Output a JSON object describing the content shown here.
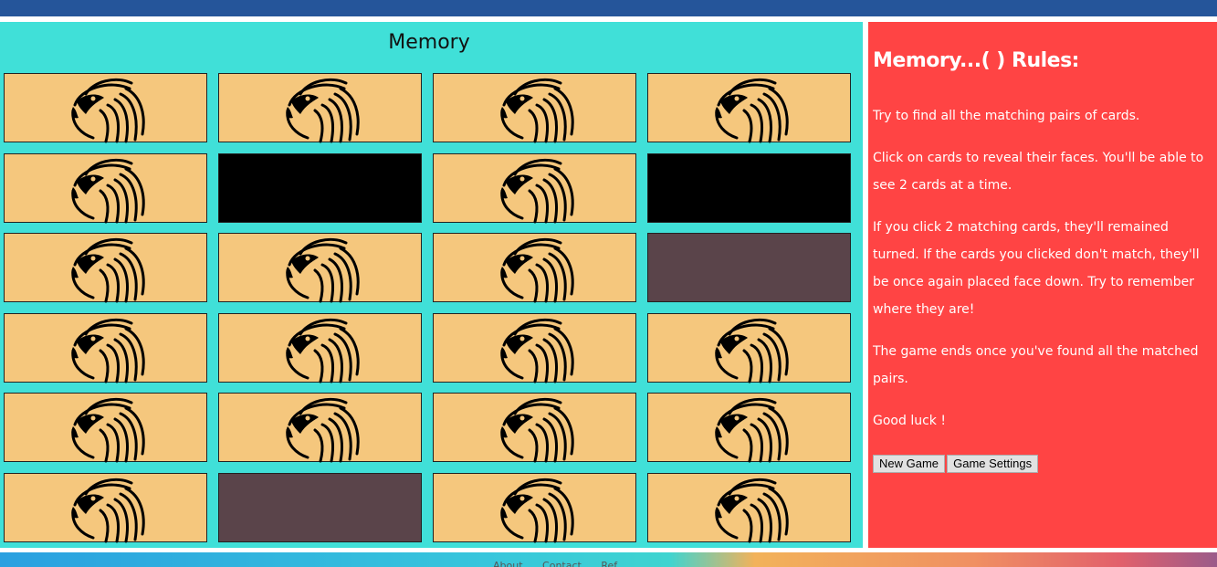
{
  "game": {
    "title": "Memory",
    "cards": [
      "face",
      "face",
      "face",
      "face",
      "face",
      "black",
      "face",
      "black",
      "face",
      "face",
      "face",
      "gray",
      "face",
      "face",
      "face",
      "face",
      "face",
      "face",
      "face",
      "face",
      "face",
      "gray",
      "face",
      "face"
    ],
    "card_icon": "eagle-head-icon"
  },
  "rules": {
    "title": "Memory...( ) Rules:",
    "paragraphs": [
      "Try to find all the matching pairs of cards.",
      "Click on cards to reveal their faces. You'll be able to see 2 cards at a time.",
      "If you click 2 matching cards, they'll remained turned. If the cards you clicked don't match, they'll be once again placed face down. Try to remember where they are!",
      "The game ends once you've found all the matched pairs.",
      "Good luck !"
    ],
    "new_game_label": "New Game",
    "settings_label": "Game Settings"
  },
  "footer": {
    "links": [
      "About",
      "Contact",
      "Ref"
    ]
  },
  "colors": {
    "topbar": "#25559a",
    "game_panel": "#40e0d8",
    "rules_panel": "#ff4444",
    "card_face": "#f5c77d",
    "card_back_dark": "#000000",
    "card_back_gray": "#5a444a"
  }
}
